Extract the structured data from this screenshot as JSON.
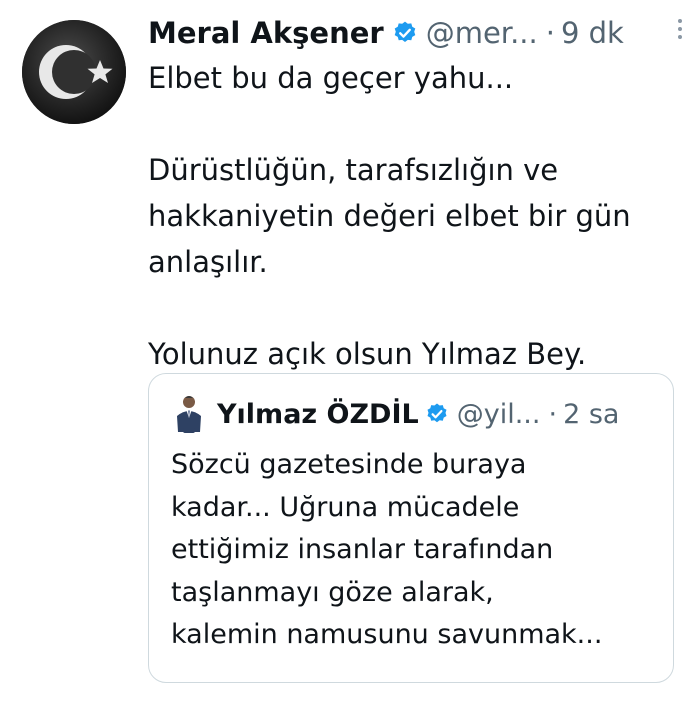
{
  "tweet": {
    "author_name": "Meral Akşener",
    "handle": "@mer...",
    "separator": "·",
    "time": "9 dk",
    "avatar_icon": "crescent-star-icon",
    "paragraphs": [
      "Elbet bu da geçer yahu...",
      "Dürüstlüğün, tarafsızlığın ve hakkaniyetin değeri elbet bir gün anlaşılır.",
      "Yolunuz açık olsun Yılmaz Bey."
    ]
  },
  "quote": {
    "author_name": "Yılmaz ÖZDİL",
    "handle": "@yil...",
    "separator": "·",
    "time": "2 sa",
    "lines": [
      "Sözcü gazetesinde buraya",
      "kadar... Uğruna mücadele",
      "ettiğimiz insanlar tarafından",
      "taşlanmayı göze alarak,",
      "kalemin namusunu savunmak..."
    ]
  },
  "colors": {
    "text": "#0f1419",
    "secondary": "#536471",
    "verified": "#1d9bf0",
    "border": "#cfd9de"
  }
}
